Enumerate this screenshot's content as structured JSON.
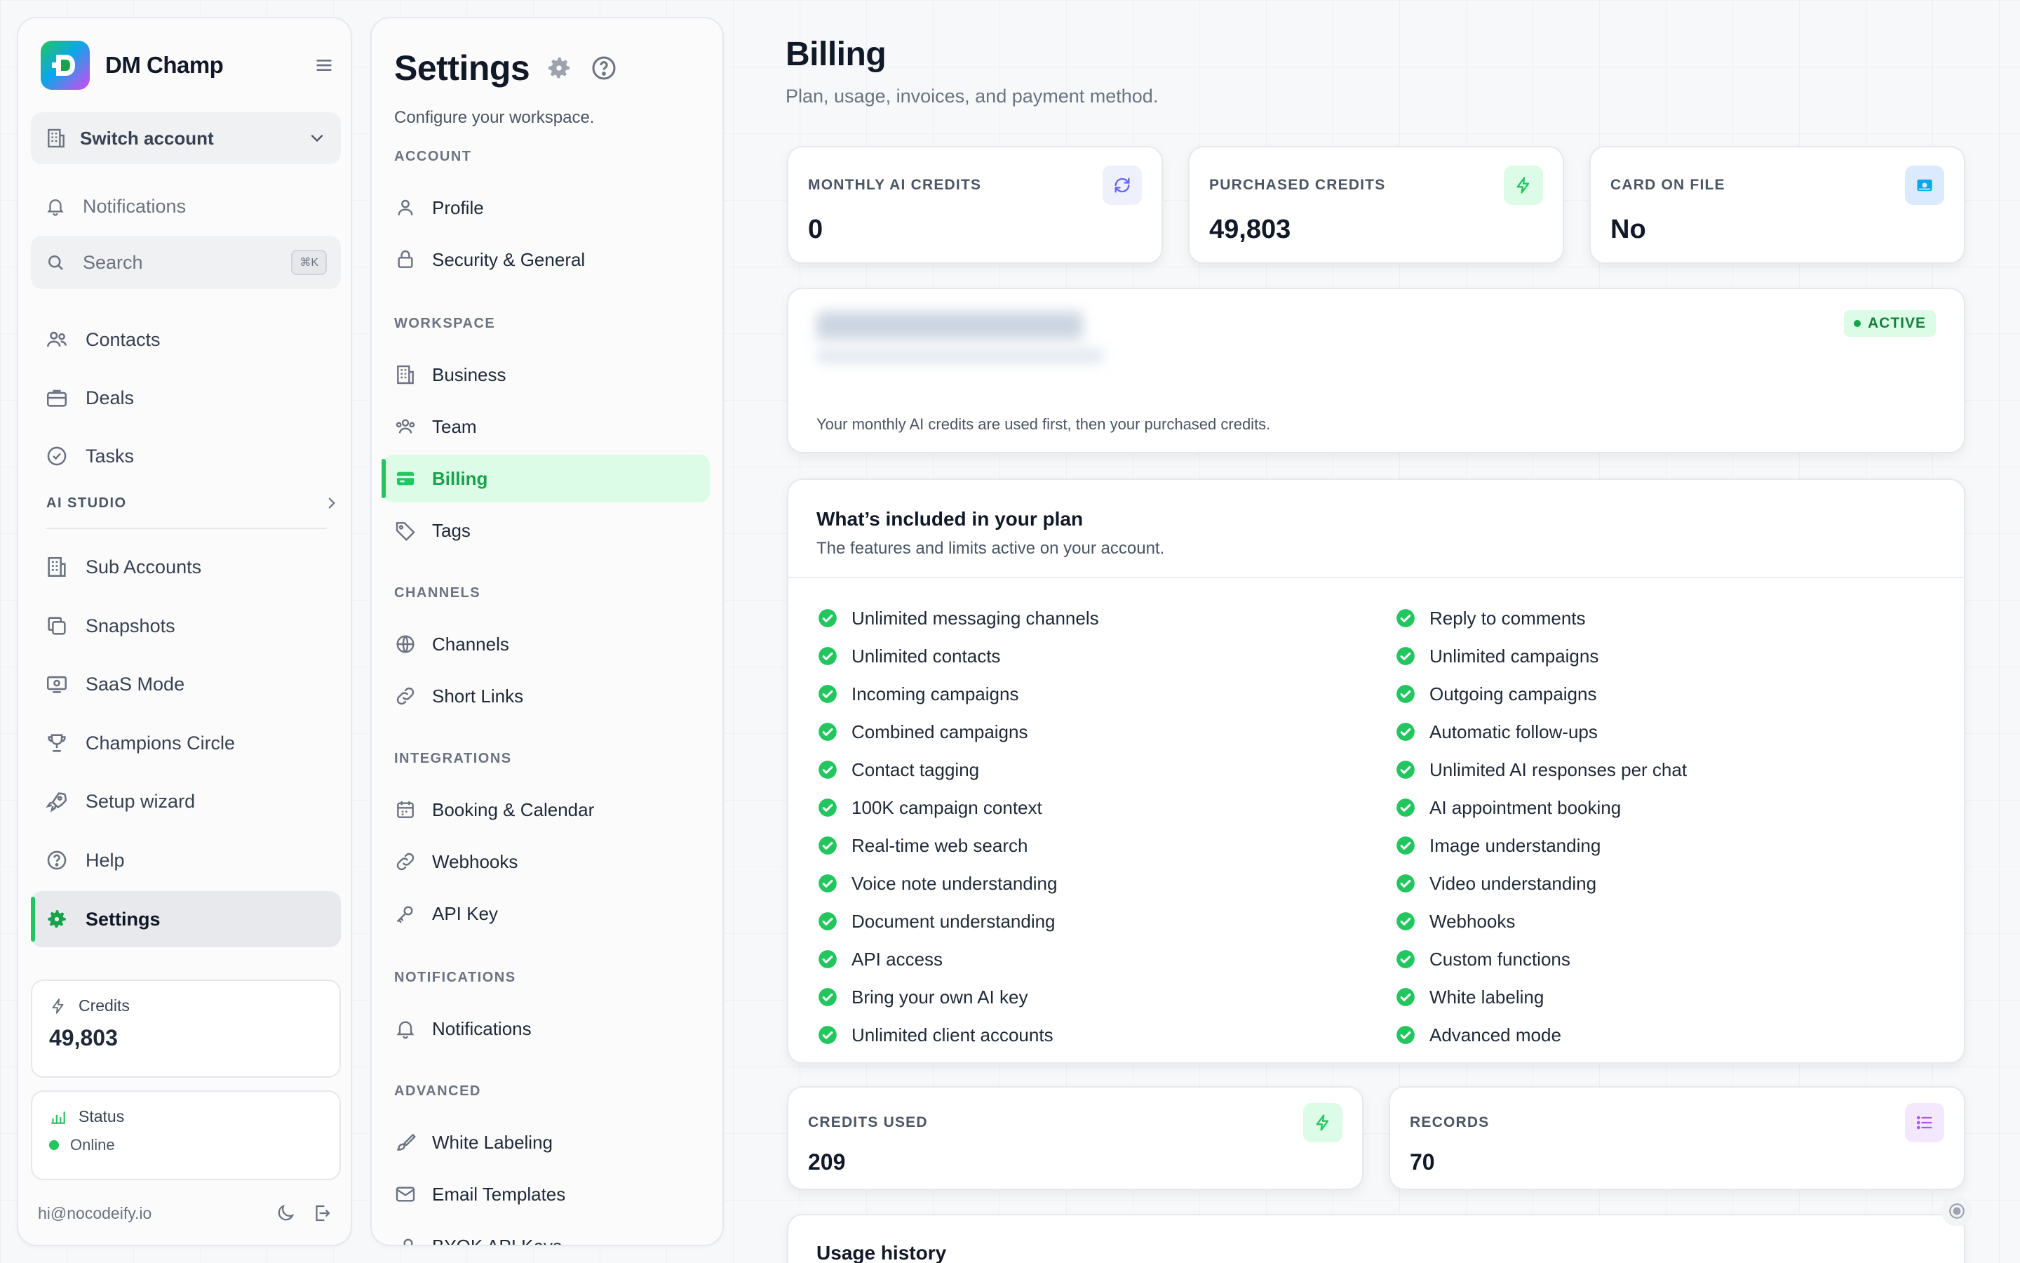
{
  "app": {
    "name": "DM Champ"
  },
  "sidebar": {
    "switch_account": "Switch account",
    "notifications": "Notifications",
    "search": {
      "label": "Search",
      "shortcut": "⌘K"
    },
    "items": [
      {
        "label": "Contacts",
        "icon": "users-icon"
      },
      {
        "label": "Deals",
        "icon": "briefcase-icon"
      },
      {
        "label": "Tasks",
        "icon": "check-circle-icon"
      }
    ],
    "ai_studio_label": "AI STUDIO",
    "items2": [
      {
        "label": "Sub Accounts",
        "icon": "building-icon"
      },
      {
        "label": "Snapshots",
        "icon": "copy-icon"
      },
      {
        "label": "SaaS Mode",
        "icon": "monitor-icon"
      },
      {
        "label": "Champions Circle",
        "icon": "trophy-icon"
      },
      {
        "label": "Setup wizard",
        "icon": "rocket-icon"
      },
      {
        "label": "Help",
        "icon": "help-circle-icon"
      },
      {
        "label": "Settings",
        "icon": "gear-icon",
        "active": true
      }
    ],
    "credits": {
      "label": "Credits",
      "value": "49,803"
    },
    "status": {
      "label": "Status",
      "value": "Online"
    },
    "user_email": "hi@nocodeify.io"
  },
  "settings_nav": {
    "title": "Settings",
    "subtitle": "Configure your workspace.",
    "groups": {
      "account": {
        "label": "ACCOUNT",
        "items": [
          "Profile",
          "Security & General"
        ]
      },
      "workspace": {
        "label": "WORKSPACE",
        "items": [
          "Business",
          "Team",
          "Billing",
          "Tags"
        ]
      },
      "channels": {
        "label": "CHANNELS",
        "items": [
          "Channels",
          "Short Links"
        ]
      },
      "integrations": {
        "label": "INTEGRATIONS",
        "items": [
          "Booking & Calendar",
          "Webhooks",
          "API Key"
        ]
      },
      "notifications": {
        "label": "NOTIFICATIONS",
        "items": [
          "Notifications"
        ]
      },
      "advanced": {
        "label": "ADVANCED",
        "items": [
          "White Labeling",
          "Email Templates",
          "BYOK API Keys"
        ]
      }
    },
    "active_item": "Billing"
  },
  "billing": {
    "title": "Billing",
    "subtitle": "Plan, usage, invoices, and payment method.",
    "stats": [
      {
        "caption": "MONTHLY AI CREDITS",
        "value": "0",
        "icon": "refresh-icon"
      },
      {
        "caption": "PURCHASED CREDITS",
        "value": "49,803",
        "icon": "lightning-icon"
      },
      {
        "caption": "CARD ON FILE",
        "value": "No",
        "icon": "credit-card-icon"
      }
    ],
    "plan": {
      "status": "ACTIVE",
      "note": "Your monthly AI credits are used first, then your purchased credits."
    },
    "included": {
      "title": "What’s included in your plan",
      "subtitle": "The features and limits active on your account.",
      "left": [
        "Unlimited messaging channels",
        "Unlimited contacts",
        "Incoming campaigns",
        "Combined campaigns",
        "Contact tagging",
        "100K campaign context",
        "Real-time web search",
        "Voice note understanding",
        "Document understanding",
        "API access",
        "Bring your own AI key",
        "Unlimited client accounts"
      ],
      "right": [
        "Reply to comments",
        "Unlimited campaigns",
        "Outgoing campaigns",
        "Automatic follow-ups",
        "Unlimited AI responses per chat",
        "AI appointment booking",
        "Image understanding",
        "Video understanding",
        "Webhooks",
        "Custom functions",
        "White labeling",
        "Advanced mode"
      ]
    },
    "usage_stats": [
      {
        "caption": "CREDITS USED",
        "value": "209",
        "icon": "lightning-icon"
      },
      {
        "caption": "RECORDS",
        "value": "70",
        "icon": "list-icon"
      }
    ],
    "usage_history_title": "Usage history"
  },
  "colors": {
    "accent": "#22c55e",
    "accent_bg": "#dcfce7"
  }
}
